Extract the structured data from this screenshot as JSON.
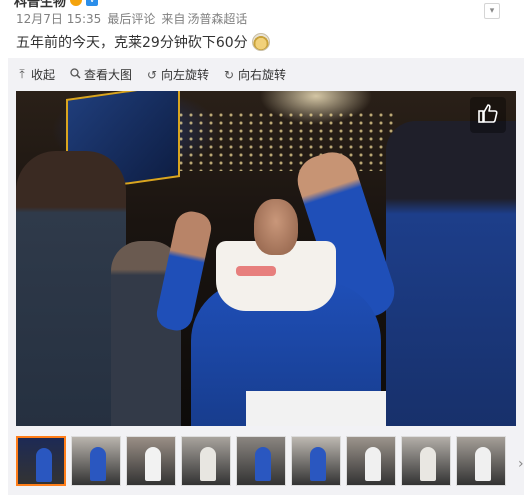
{
  "post": {
    "author": "科普生物",
    "vip_badge": "V",
    "date": "12月7日 15:35",
    "latest_comments": "最后评论",
    "source_prefix": "来自",
    "source": "汤普森超话",
    "text": "五年前的今天，克莱29分钟砍下60分",
    "emoji": "crown-medal-emoji"
  },
  "toolbar": {
    "collapse": "收起",
    "view_large": "查看大图",
    "rotate_left": "向左旋转",
    "rotate_right": "向右旋转"
  },
  "colors": {
    "active_thumb_border": "#ff7e1a",
    "panel_bg": "#f2f2f5",
    "vip_blue": "#2b8eea",
    "verified_gold": "#f4a30c"
  },
  "icons": {
    "collapse": "upload-arrow-icon",
    "view_large": "magnifier-icon",
    "rotate_left": "rotate-left-icon",
    "rotate_right": "rotate-right-icon",
    "like": "thumbs-up-icon",
    "options": "chevron-down-icon"
  },
  "thumbnails": [
    {
      "bg": "#1d2a55",
      "fig": "#2a57c0",
      "active": true
    },
    {
      "bg": "#b9b4ad",
      "fig": "#2a57c0"
    },
    {
      "bg": "#9a8f86",
      "fig": "#f2f2f2"
    },
    {
      "bg": "#a8a39d",
      "fig": "#e8e6e1"
    },
    {
      "bg": "#8a8580",
      "fig": "#2a57c0"
    },
    {
      "bg": "#bdb8b1",
      "fig": "#2a57c0"
    },
    {
      "bg": "#9c948c",
      "fig": "#f0f0f0"
    },
    {
      "bg": "#b3aea8",
      "fig": "#e9e7e2"
    },
    {
      "bg": "#a59f98",
      "fig": "#f0f0f0"
    }
  ]
}
